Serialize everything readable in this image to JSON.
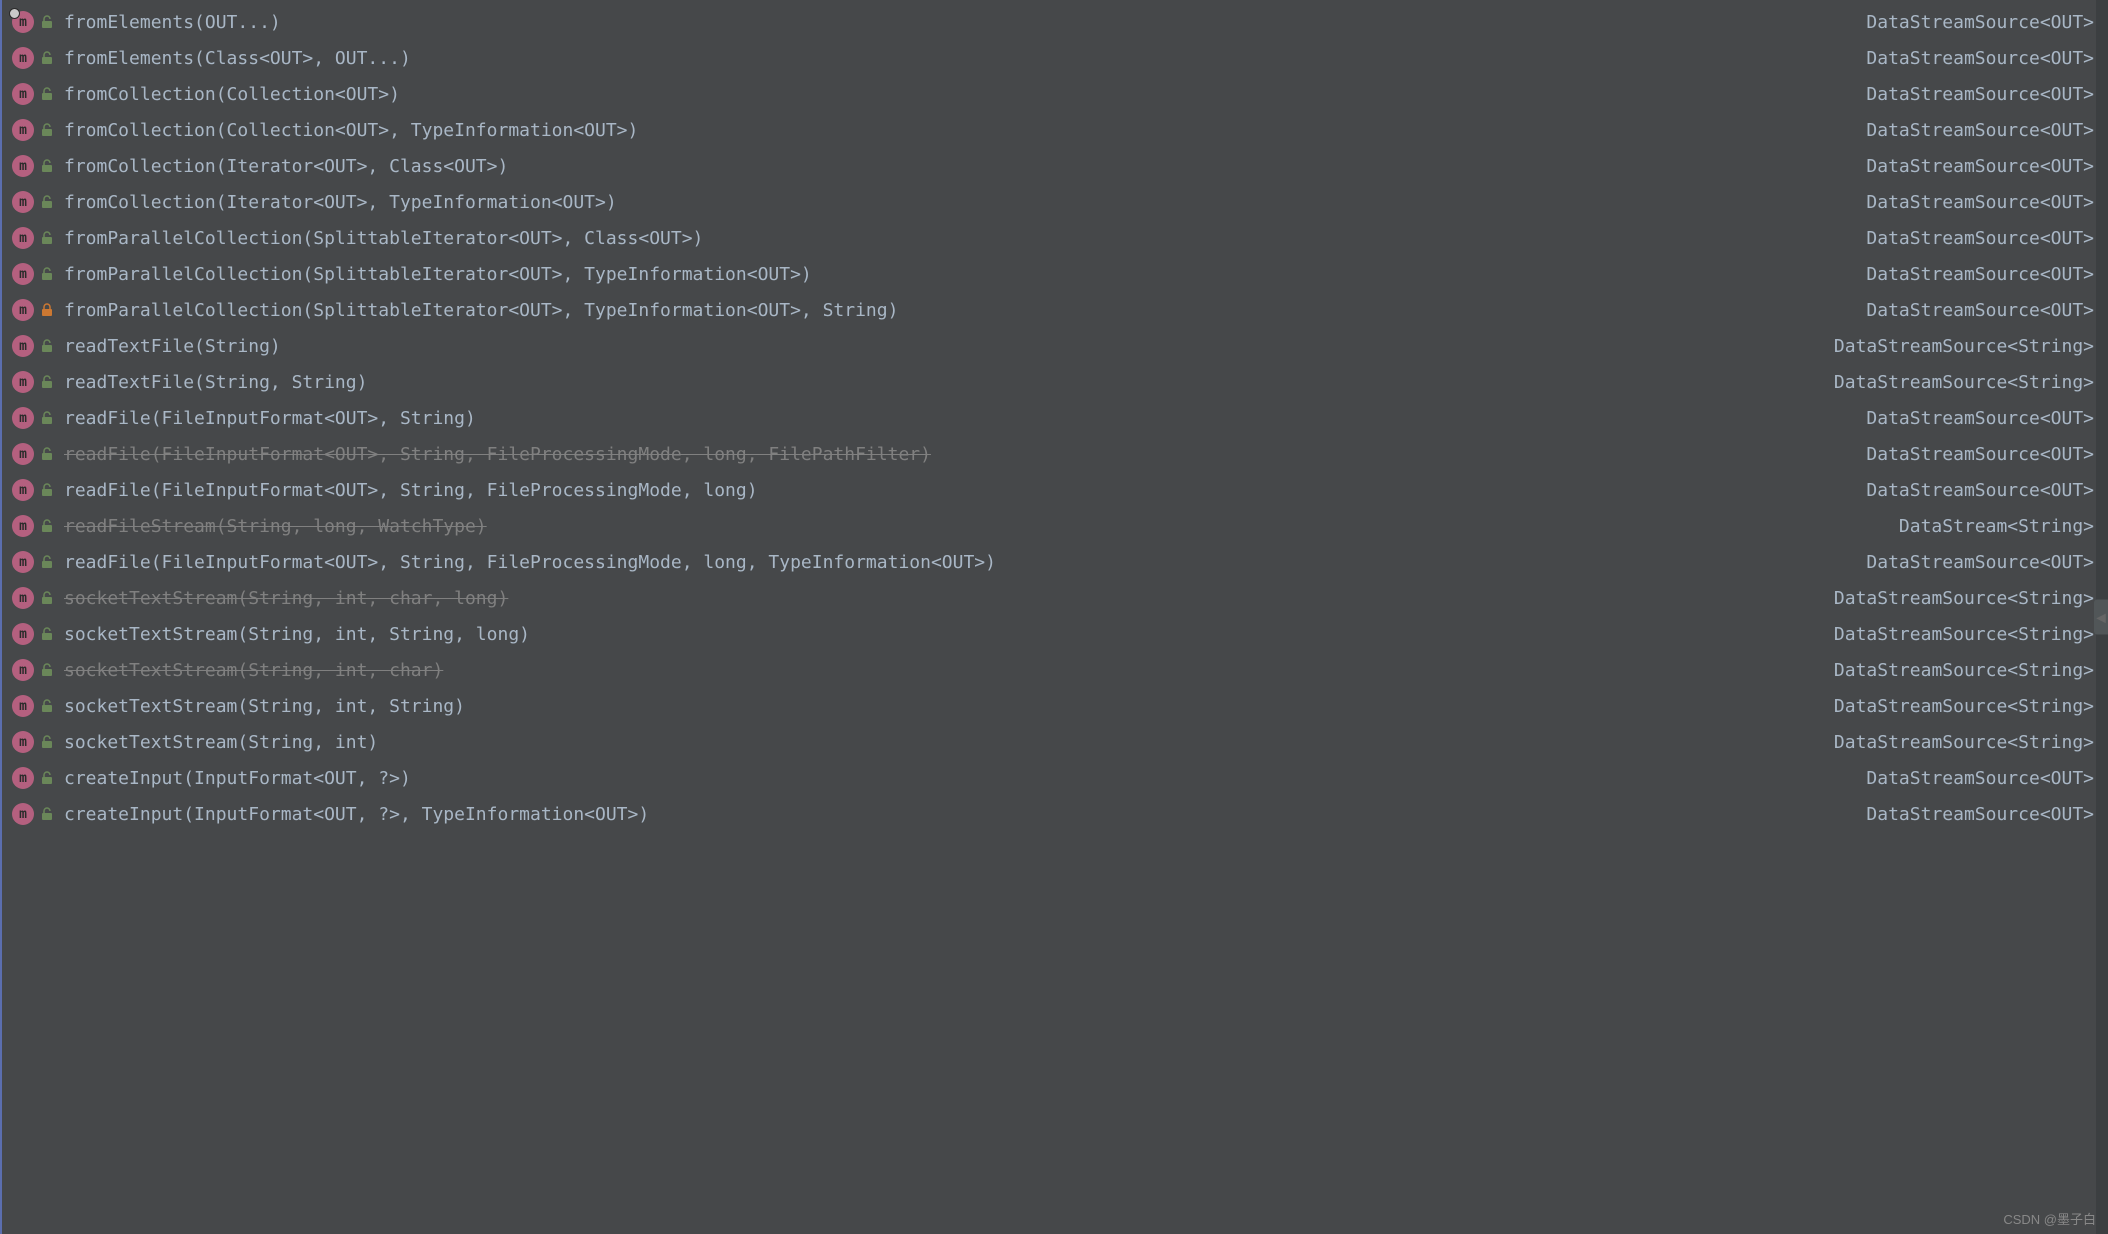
{
  "icons": {
    "method_letter": "m",
    "lock_open": "🔓",
    "lock_closed": "🔒",
    "chevron": "◀"
  },
  "watermark": "CSDN @墨子白",
  "completions": [
    {
      "signature": "fromElements(OUT...)",
      "returnType": "DataStreamSource<OUT>",
      "visibility": "public",
      "deprecated": false,
      "hasDot": true
    },
    {
      "signature": "fromElements(Class<OUT>, OUT...)",
      "returnType": "DataStreamSource<OUT>",
      "visibility": "public",
      "deprecated": false,
      "hasDot": false
    },
    {
      "signature": "fromCollection(Collection<OUT>)",
      "returnType": "DataStreamSource<OUT>",
      "visibility": "public",
      "deprecated": false,
      "hasDot": false
    },
    {
      "signature": "fromCollection(Collection<OUT>, TypeInformation<OUT>)",
      "returnType": "DataStreamSource<OUT>",
      "visibility": "public",
      "deprecated": false,
      "hasDot": false
    },
    {
      "signature": "fromCollection(Iterator<OUT>, Class<OUT>)",
      "returnType": "DataStreamSource<OUT>",
      "visibility": "public",
      "deprecated": false,
      "hasDot": false
    },
    {
      "signature": "fromCollection(Iterator<OUT>, TypeInformation<OUT>)",
      "returnType": "DataStreamSource<OUT>",
      "visibility": "public",
      "deprecated": false,
      "hasDot": false
    },
    {
      "signature": "fromParallelCollection(SplittableIterator<OUT>, Class<OUT>)",
      "returnType": "DataStreamSource<OUT>",
      "visibility": "public",
      "deprecated": false,
      "hasDot": false
    },
    {
      "signature": "fromParallelCollection(SplittableIterator<OUT>, TypeInformation<OUT>)",
      "returnType": "DataStreamSource<OUT>",
      "visibility": "public",
      "deprecated": false,
      "hasDot": false
    },
    {
      "signature": "fromParallelCollection(SplittableIterator<OUT>, TypeInformation<OUT>, String)",
      "returnType": "DataStreamSource<OUT>",
      "visibility": "private",
      "deprecated": false,
      "hasDot": false
    },
    {
      "signature": "readTextFile(String)",
      "returnType": "DataStreamSource<String>",
      "visibility": "public",
      "deprecated": false,
      "hasDot": false
    },
    {
      "signature": "readTextFile(String, String)",
      "returnType": "DataStreamSource<String>",
      "visibility": "public",
      "deprecated": false,
      "hasDot": false
    },
    {
      "signature": "readFile(FileInputFormat<OUT>, String)",
      "returnType": "DataStreamSource<OUT>",
      "visibility": "public",
      "deprecated": false,
      "hasDot": false
    },
    {
      "signature": "readFile(FileInputFormat<OUT>, String, FileProcessingMode, long, FilePathFilter)",
      "returnType": "DataStreamSource<OUT>",
      "visibility": "public",
      "deprecated": true,
      "hasDot": false
    },
    {
      "signature": "readFile(FileInputFormat<OUT>, String, FileProcessingMode, long)",
      "returnType": "DataStreamSource<OUT>",
      "visibility": "public",
      "deprecated": false,
      "hasDot": false
    },
    {
      "signature": "readFileStream(String, long, WatchType)",
      "returnType": "DataStream<String>",
      "visibility": "public",
      "deprecated": true,
      "hasDot": false
    },
    {
      "signature": "readFile(FileInputFormat<OUT>, String, FileProcessingMode, long, TypeInformation<OUT>)",
      "returnType": "DataStreamSource<OUT>",
      "visibility": "public",
      "deprecated": false,
      "hasDot": false
    },
    {
      "signature": "socketTextStream(String, int, char, long)",
      "returnType": "DataStreamSource<String>",
      "visibility": "public",
      "deprecated": true,
      "hasDot": false
    },
    {
      "signature": "socketTextStream(String, int, String, long)",
      "returnType": "DataStreamSource<String>",
      "visibility": "public",
      "deprecated": false,
      "hasDot": false
    },
    {
      "signature": "socketTextStream(String, int, char)",
      "returnType": "DataStreamSource<String>",
      "visibility": "public",
      "deprecated": true,
      "hasDot": false
    },
    {
      "signature": "socketTextStream(String, int, String)",
      "returnType": "DataStreamSource<String>",
      "visibility": "public",
      "deprecated": false,
      "hasDot": false
    },
    {
      "signature": "socketTextStream(String, int)",
      "returnType": "DataStreamSource<String>",
      "visibility": "public",
      "deprecated": false,
      "hasDot": false
    },
    {
      "signature": "createInput(InputFormat<OUT, ?>)",
      "returnType": "DataStreamSource<OUT>",
      "visibility": "public",
      "deprecated": false,
      "hasDot": false
    },
    {
      "signature": "createInput(InputFormat<OUT, ?>, TypeInformation<OUT>)",
      "returnType": "DataStreamSource<OUT>",
      "visibility": "public",
      "deprecated": false,
      "hasDot": false
    }
  ]
}
